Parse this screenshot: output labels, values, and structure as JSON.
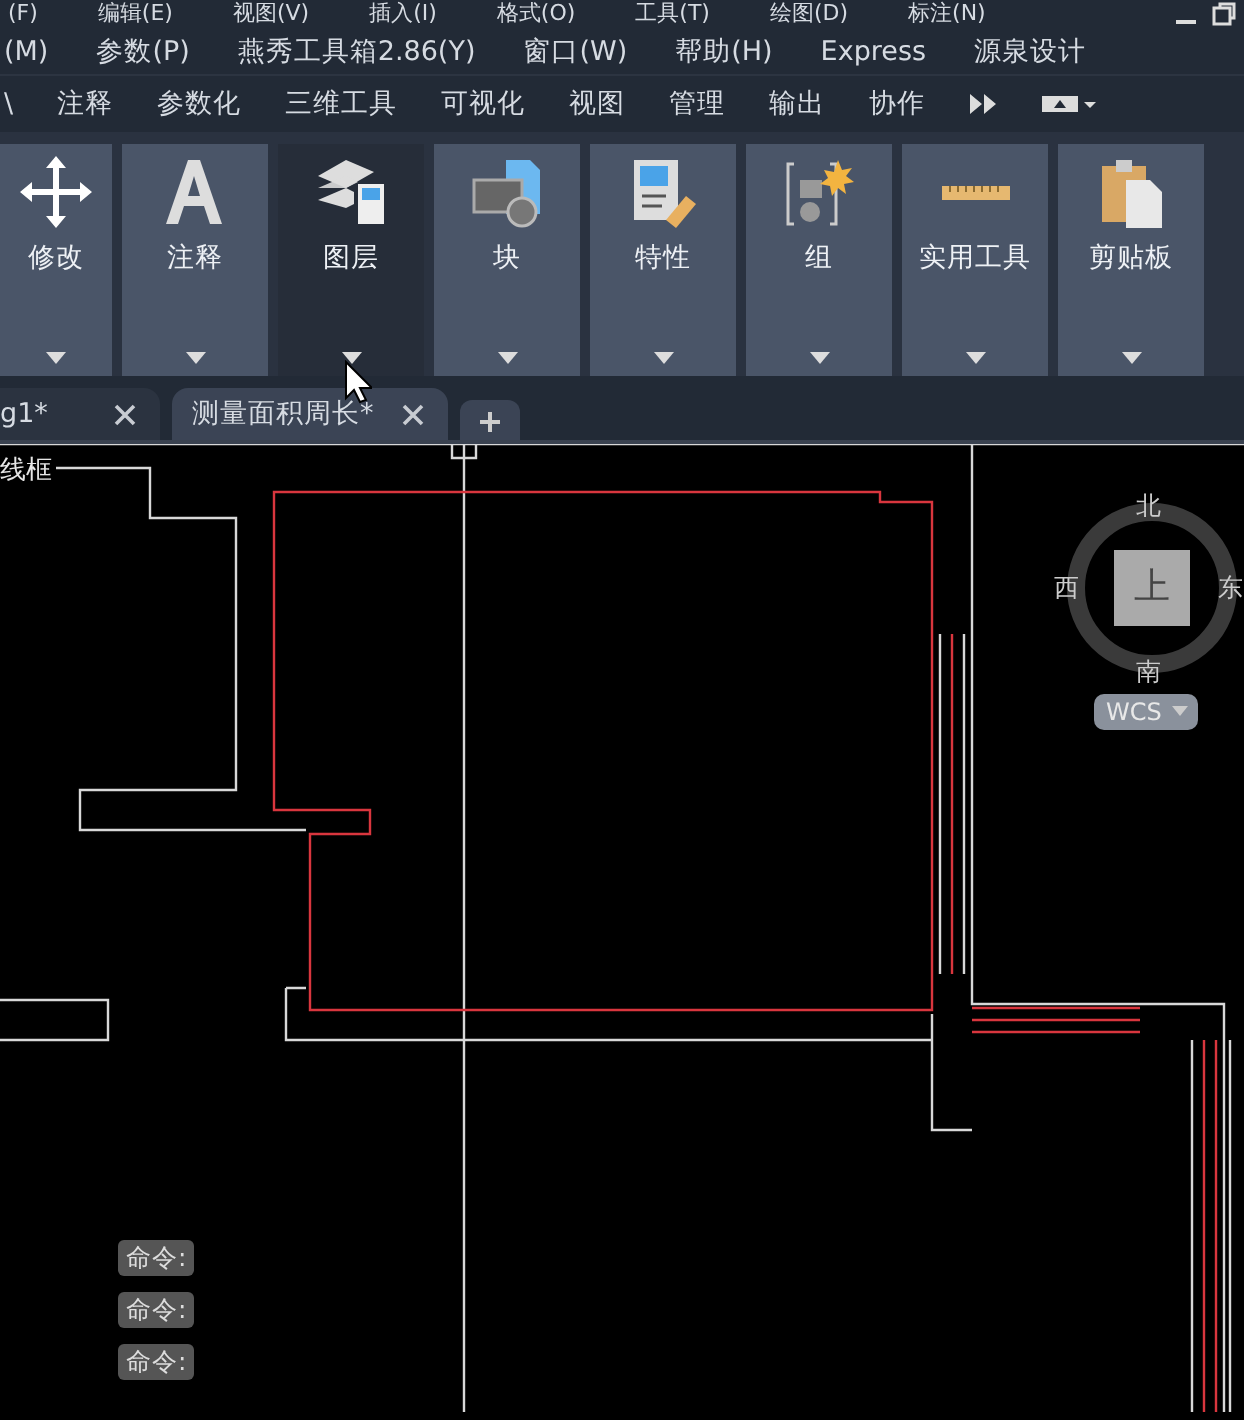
{
  "menu_bar_top": [
    "(F)",
    "编辑(E)",
    "视图(V)",
    "插入(I)",
    "格式(O)",
    "工具(T)",
    "绘图(D)",
    "标注(N)"
  ],
  "menu_bar": [
    "(M)",
    "参数(P)",
    "燕秀工具箱2.86(Y)",
    "窗口(W)",
    "帮助(H)",
    "Express",
    "源泉设计"
  ],
  "ribbon_tabs": [
    "\\",
    "注释",
    "参数化",
    "三维工具",
    "可视化",
    "视图",
    "管理",
    "输出",
    "协作"
  ],
  "ribbon_panels": [
    {
      "label": "修改",
      "hovered": false
    },
    {
      "label": "注释",
      "hovered": false
    },
    {
      "label": "图层",
      "hovered": true
    },
    {
      "label": "块",
      "hovered": false
    },
    {
      "label": "特性",
      "hovered": false
    },
    {
      "label": "组",
      "hovered": false
    },
    {
      "label": "实用工具",
      "hovered": false
    },
    {
      "label": "剪贴板",
      "hovered": false
    }
  ],
  "document_tabs": [
    {
      "label": "g1*",
      "selected": false
    },
    {
      "label": "测量面积周长*",
      "selected": true
    }
  ],
  "viewport_label": "线框",
  "viewcube": {
    "north": "北",
    "west": "西",
    "east": "东",
    "south": "南",
    "face": "上",
    "ucs": "WCS"
  },
  "command_history": [
    "命令:",
    "命令:",
    "命令:"
  ]
}
